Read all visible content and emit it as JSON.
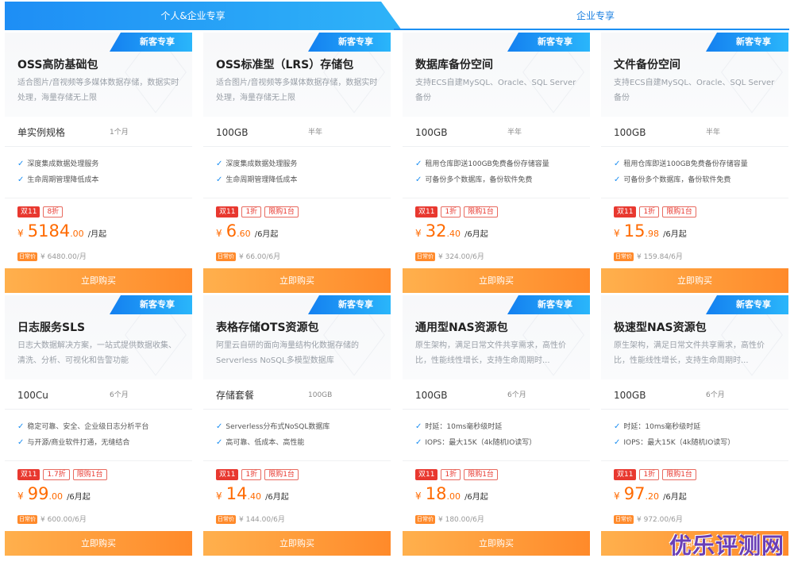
{
  "tabs": {
    "personal": "个人&企业专享",
    "enterprise": "企业专享"
  },
  "buy_label": "立即购买",
  "new_badge": "新客专享",
  "orig_tag": "日常价",
  "cards": [
    {
      "title": "OSS高防基础包",
      "desc": "适合图片/音视频等多媒体数据存储，数据实时处理，海量存储无上限",
      "spec": "单实例规格",
      "duration": "1个月",
      "features": [
        "深度集成数据处理服务",
        "生命周期管理降低成本"
      ],
      "tags": [
        "双11",
        "8折"
      ],
      "price_int": "5184",
      "price_dec": ".00",
      "price_unit": "/月起",
      "original": "¥ 6480.00/月"
    },
    {
      "title": "OSS标准型（LRS）存储包",
      "desc": "适合图片/音视频等多媒体数据存储，数据实时处理，海量存储无上限",
      "spec": "100GB",
      "duration": "半年",
      "features": [
        "深度集成数据处理服务",
        "生命周期管理降低成本"
      ],
      "tags": [
        "双11",
        "1折",
        "限购1台"
      ],
      "price_int": "6",
      "price_dec": ".60",
      "price_unit": "/6月起",
      "original": "¥ 66.00/6月"
    },
    {
      "title": "数据库备份空间",
      "desc": "支持ECS自建MySQL、Oracle、SQL Server备份",
      "spec": "100GB",
      "duration": "半年",
      "features": [
        "租用仓库即送100GB免费备份存储容量",
        "可备份多个数据库，备份软件免费"
      ],
      "tags": [
        "双11",
        "1折",
        "限购1台"
      ],
      "price_int": "32",
      "price_dec": ".40",
      "price_unit": "/6月起",
      "original": "¥ 324.00/6月"
    },
    {
      "title": "文件备份空间",
      "desc": "支持ECS自建MySQL、Oracle、SQL Server备份",
      "spec": "100GB",
      "duration": "半年",
      "features": [
        "租用仓库即送100GB免费备份存储容量",
        "可备份多个数据库，备份软件免费"
      ],
      "tags": [
        "双11",
        "1折",
        "限购1台"
      ],
      "price_int": "15",
      "price_dec": ".98",
      "price_unit": "/6月起",
      "original": "¥ 159.84/6月"
    },
    {
      "title": "日志服务SLS",
      "desc": "日志大数据解决方案，一站式提供数据收集、清洗、分析、可视化和告警功能",
      "spec": "100Cu",
      "duration": "6个月",
      "features": [
        "稳定可靠、安全、企业级日志分析平台",
        "与开源/商业软件打通，无缝结合"
      ],
      "tags": [
        "双11",
        "1.7折",
        "限购1台"
      ],
      "price_int": "99",
      "price_dec": ".00",
      "price_unit": "/6月起",
      "original": "¥ 600.00/6月"
    },
    {
      "title": "表格存储OTS资源包",
      "desc": "阿里云自研的面向海量结构化数据存储的Serverless NoSQL多模型数据库",
      "spec": "存储套餐",
      "duration": "100GB",
      "features": [
        "Serverless分布式NoSQL数据库",
        "高可靠、低成本、高性能"
      ],
      "tags": [
        "双11",
        "1折",
        "限购1台"
      ],
      "price_int": "14",
      "price_dec": ".40",
      "price_unit": "/6月起",
      "original": "¥ 144.00/6月"
    },
    {
      "title": "通用型NAS资源包",
      "desc": "原生架构，满足日常文件共享需求，高性价比，性能线性增长，支持生命周期时...",
      "spec": "100GB",
      "duration": "6个月",
      "features": [
        "时延：10ms毫秒级时延",
        "IOPS：最大15K（4k随机IO读写）"
      ],
      "tags": [
        "双11",
        "1折",
        "限购1台"
      ],
      "price_int": "18",
      "price_dec": ".00",
      "price_unit": "/6月起",
      "original": "¥ 180.00/6月"
    },
    {
      "title": "极速型NAS资源包",
      "desc": "原生架构，满足日常文件共享需求，高性价比，性能线性增长，支持生命周期时...",
      "spec": "100GB",
      "duration": "6个月",
      "features": [
        "时延：10ms毫秒级时延",
        "IOPS：最大15K（4k随机IO读写）"
      ],
      "tags": [
        "双11",
        "1折",
        "限购1台"
      ],
      "price_int": "97",
      "price_dec": ".20",
      "price_unit": "/6月起",
      "original": "¥ 972.00/6月"
    }
  ],
  "watermark": "优乐评测网",
  "colors": {
    "accent_blue": "#1c8ff2",
    "price_orange": "#ff6a00",
    "buy_orange": "#ff8a2a",
    "tag_red": "#e8382f"
  }
}
